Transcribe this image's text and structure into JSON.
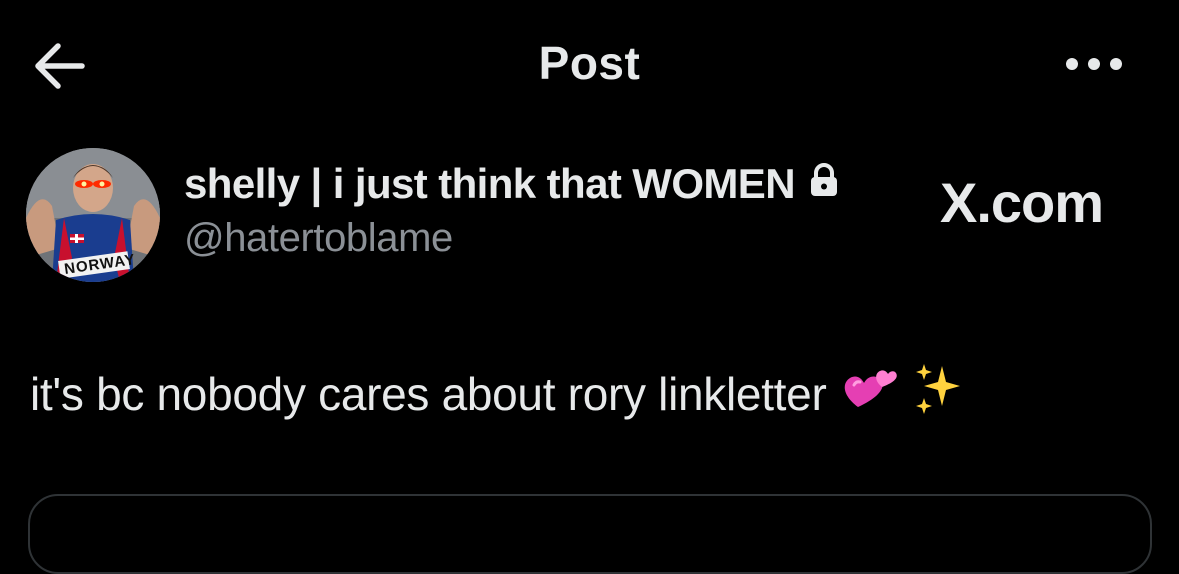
{
  "header": {
    "title": "Post",
    "back_icon": "arrow-left-icon",
    "more_icon": "more-horizontal-icon"
  },
  "post": {
    "author": {
      "display_name": "shelly | i just think that WOMEN",
      "handle": "@hatertoblame",
      "protected_icon": "lock-icon",
      "avatar_shirt_text": "NORWAY"
    },
    "text": "it's bc nobody cares about rory linkletter",
    "emojis": [
      "two-hearts-emoji",
      "sparkles-emoji"
    ]
  },
  "watermark": "X.com",
  "colors": {
    "background": "#000000",
    "primary_text": "#e7e9ea",
    "secondary_text": "#8b9096",
    "border": "#2f3336"
  }
}
